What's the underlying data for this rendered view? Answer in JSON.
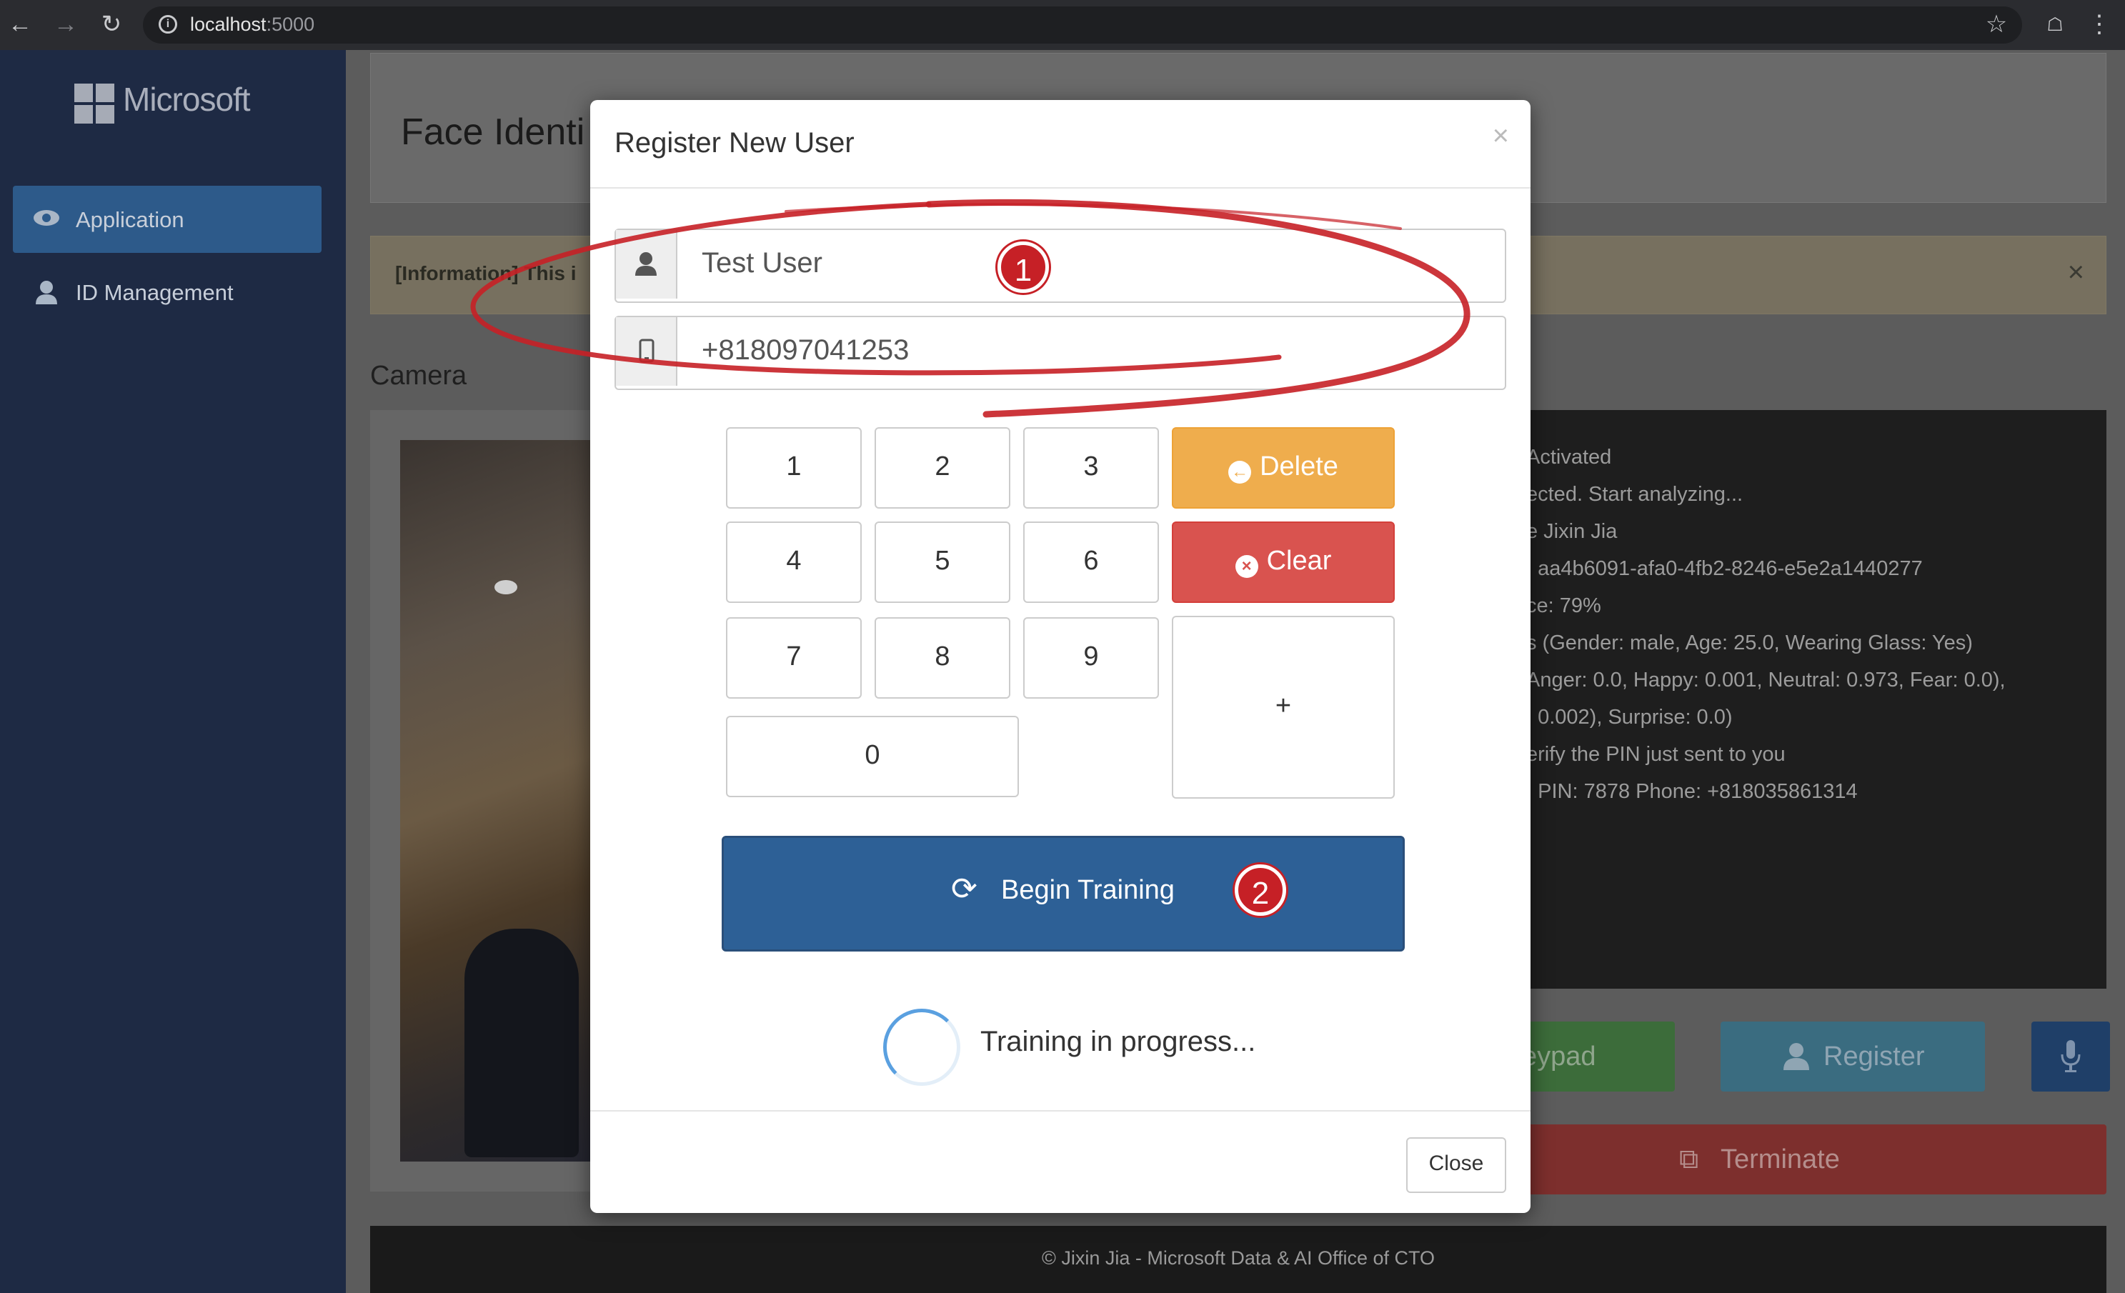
{
  "browser": {
    "url_host": "localhost",
    "url_port": ":5000"
  },
  "sidebar": {
    "brand": "Microsoft",
    "items": [
      {
        "label": "Application",
        "icon": "eye-icon",
        "active": true
      },
      {
        "label": "ID Management",
        "icon": "user-icon",
        "active": false
      }
    ]
  },
  "main": {
    "title": "Face Identi",
    "info_label": "[Information] This i",
    "camera_heading": "Camera",
    "log_lines": [
      "Activated",
      "ected. Start analyzing...",
      "e Jixin Jia",
      ": aa4b6091-afa0-4fb2-8246-e5e2a1440277",
      "ce: 79%",
      "s (Gender: male, Age: 25.0, Wearing Glass: Yes)",
      "Anger: 0.0, Happy: 0.001, Neutral: 0.973, Fear: 0.0),",
      ": 0.002), Surprise: 0.0)",
      "erify the PIN just sent to you",
      "] PIN: 7878 Phone: +818035861314"
    ],
    "buttons": {
      "keypad": "eypad",
      "register": "Register",
      "terminate": "Terminate"
    },
    "footer": "© Jixin Jia - Microsoft Data & AI Office of CTO"
  },
  "modal": {
    "title": "Register New User",
    "close_x": "×",
    "name_value": "Test User",
    "phone_value": "+818097041253",
    "keys": [
      "1",
      "2",
      "3",
      "4",
      "5",
      "6",
      "7",
      "8",
      "9",
      "0",
      "+"
    ],
    "delete_label": "Delete",
    "clear_label": "Clear",
    "train_label": "Begin Training",
    "progress_text": "Training in progress...",
    "close_label": "Close"
  },
  "annotations": {
    "badge_1": "1",
    "badge_2": "2",
    "color": "#c62026"
  }
}
